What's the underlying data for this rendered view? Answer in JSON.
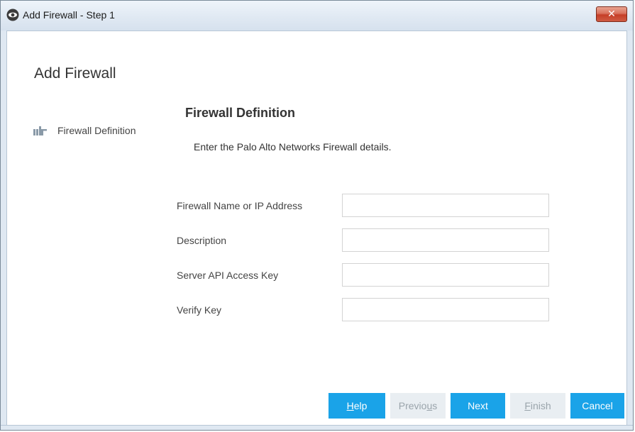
{
  "window": {
    "title": "Add Firewall - Step 1",
    "close_label": "✕"
  },
  "main": {
    "heading": "Add Firewall"
  },
  "steps": [
    {
      "label": "Firewall Definition",
      "icon": "pointing-hand-icon"
    }
  ],
  "section": {
    "title": "Firewall Definition",
    "description": "Enter the Palo Alto Networks Firewall details."
  },
  "fields": [
    {
      "label": "Firewall Name or IP Address",
      "value": ""
    },
    {
      "label": "Description",
      "value": ""
    },
    {
      "label": "Server API Access Key",
      "value": ""
    },
    {
      "label": "Verify Key",
      "value": ""
    }
  ],
  "buttons": {
    "help": {
      "mnemonic": "H",
      "rest": "elp"
    },
    "previous": {
      "pre": "Previo",
      "mnemonic": "u",
      "rest": "s"
    },
    "next": {
      "label": "Next"
    },
    "finish": {
      "mnemonic": "F",
      "rest": "inish"
    },
    "cancel": {
      "label": "Cancel"
    }
  },
  "colors": {
    "accent": "#1aa3e8",
    "disabled": "#e9eef2",
    "close": "#c53f28"
  }
}
